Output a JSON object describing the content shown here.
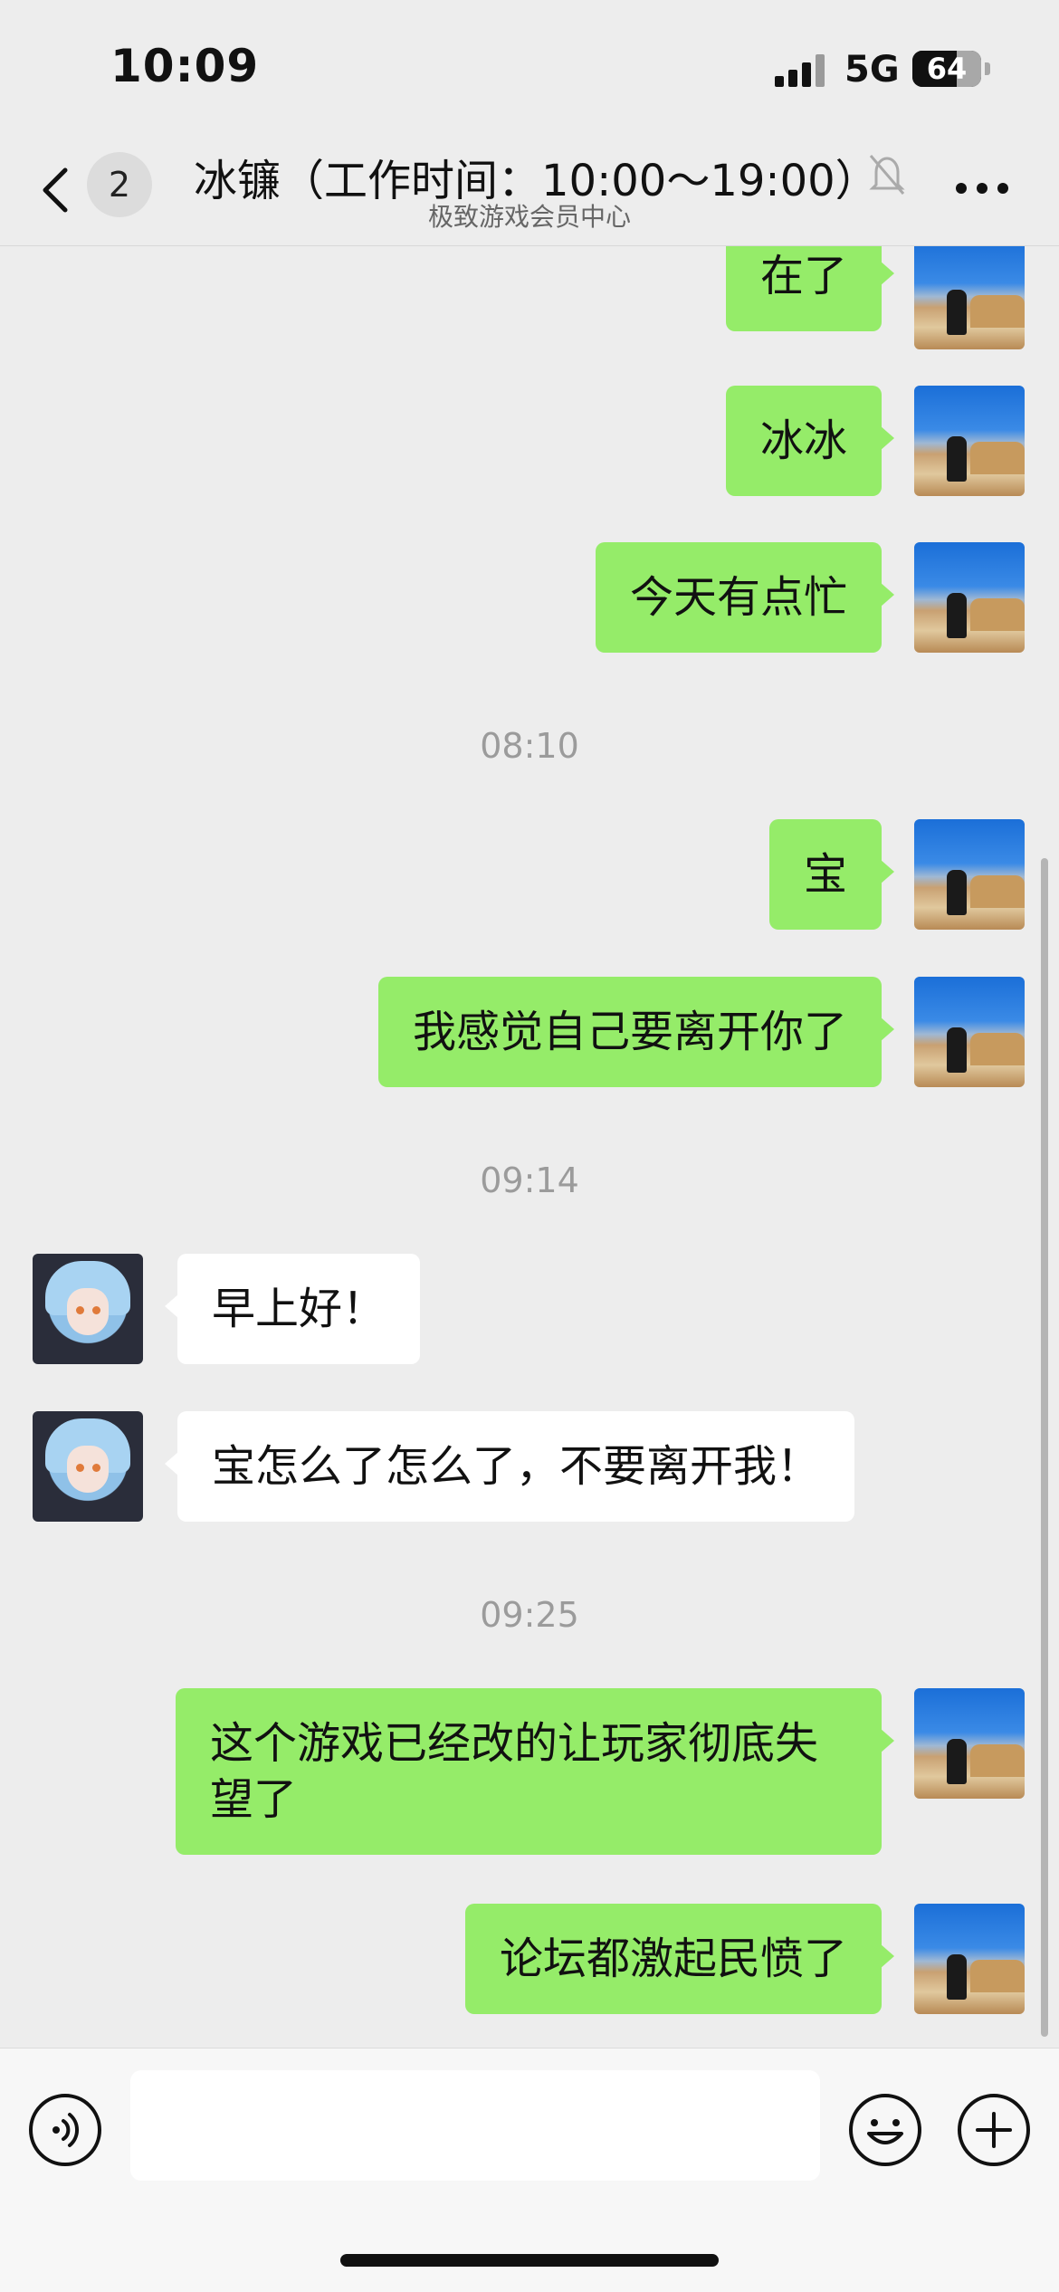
{
  "status_bar": {
    "time": "10:09",
    "network": "5G",
    "battery": "64",
    "battery_level": 0.64
  },
  "nav": {
    "unread_count": "2",
    "title": "冰镰（工作时间：10:00～19:00）",
    "subtitle": "极致游戏会员中心"
  },
  "messages": [
    {
      "side": "out",
      "text": "在了"
    },
    {
      "side": "out",
      "text": "冰冰"
    },
    {
      "side": "out",
      "text": "今天有点忙"
    },
    {
      "time": "08:10"
    },
    {
      "side": "out",
      "text": "宝"
    },
    {
      "side": "out",
      "text": "我感觉自己要离开你了"
    },
    {
      "time": "09:14"
    },
    {
      "side": "in",
      "text": "早上好！"
    },
    {
      "side": "in",
      "text": "宝怎么了怎么了，不要离开我！"
    },
    {
      "time": "09:25"
    },
    {
      "side": "out",
      "text": "这个游戏已经改的让玩家彻底失望了"
    },
    {
      "side": "out",
      "text": "论坛都激起民愤了"
    }
  ],
  "icons": {
    "back": "chevron-left-icon",
    "mute": "bell-slash-icon",
    "more": "more-dots-icon",
    "voice": "voice-icon",
    "emoji": "emoji-icon",
    "plus": "plus-icon"
  },
  "colors": {
    "outgoing_bubble": "#95ec69",
    "incoming_bubble": "#ffffff",
    "background": "#ededed"
  }
}
